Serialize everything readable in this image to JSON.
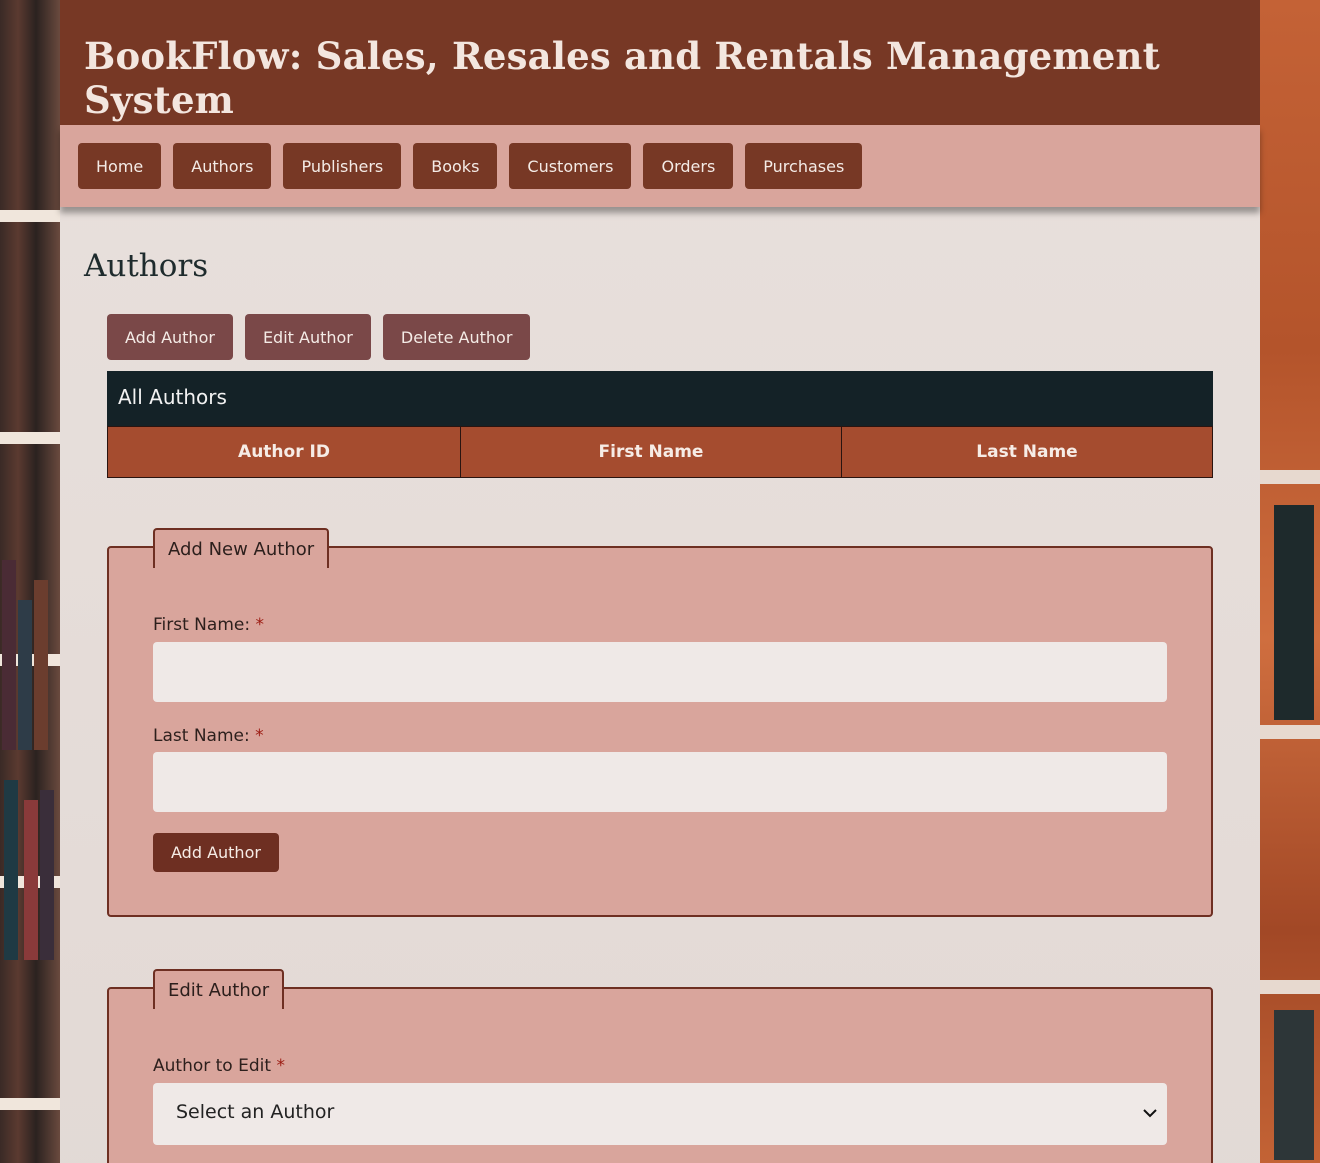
{
  "app": {
    "title": "BookFlow: Sales, Resales and Rentals Management System"
  },
  "nav": {
    "items": [
      {
        "label": "Home"
      },
      {
        "label": "Authors"
      },
      {
        "label": "Publishers"
      },
      {
        "label": "Books"
      },
      {
        "label": "Customers"
      },
      {
        "label": "Orders"
      },
      {
        "label": "Purchases"
      }
    ]
  },
  "page": {
    "title": "Authors"
  },
  "actions": {
    "add": "Add Author",
    "edit": "Edit Author",
    "delete": "Delete Author"
  },
  "table": {
    "caption": "All Authors",
    "columns": [
      "Author ID",
      "First Name",
      "Last Name"
    ],
    "rows": []
  },
  "add_form": {
    "legend": "Add New Author",
    "first_name_label": "First Name:",
    "last_name_label": "Last Name:",
    "required_marker": "*",
    "first_name_value": "",
    "last_name_value": "",
    "submit_label": "Add Author"
  },
  "edit_form": {
    "legend": "Edit Author",
    "author_label": "Author to Edit",
    "required_marker": "*",
    "select_value": "Select an Author"
  },
  "colors": {
    "header": "#773825",
    "nav_bg": "#d9a59c",
    "nav_button": "#773825",
    "action_button": "#7a4848",
    "table_caption": "#142227",
    "table_header": "#a54c2f",
    "fieldset_bg": "#d9a59c",
    "required": "#9c1b12"
  },
  "icons": {
    "select_arrow": "chevron-down-icon"
  }
}
